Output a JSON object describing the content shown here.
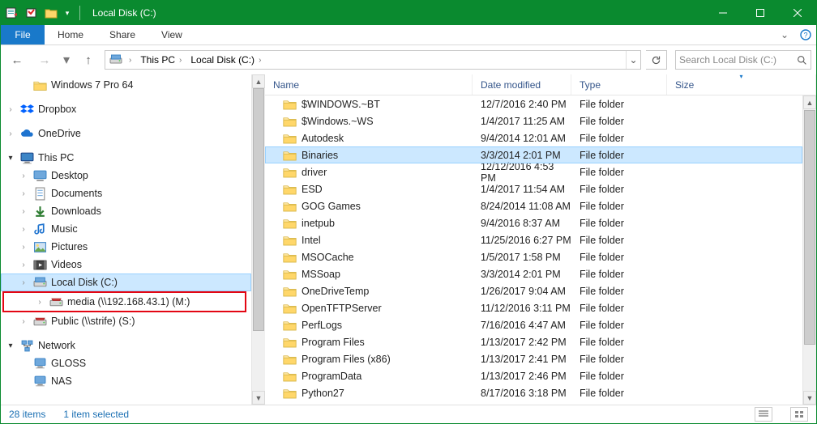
{
  "titlebar": {
    "title": "Local Disk (C:)"
  },
  "ribbon": {
    "file": "File",
    "home": "Home",
    "share": "Share",
    "view": "View"
  },
  "address": {
    "crumbs": [
      "This PC",
      "Local Disk (C:)",
      ""
    ],
    "search_placeholder": "Search Local Disk (C:)"
  },
  "tree": {
    "quick_access": "Windows 7 Pro 64",
    "dropbox": "Dropbox",
    "onedrive": "OneDrive",
    "this_pc": "This PC",
    "children": {
      "desktop": "Desktop",
      "documents": "Documents",
      "downloads": "Downloads",
      "music": "Music",
      "pictures": "Pictures",
      "videos": "Videos",
      "local_disk": "Local Disk (C:)",
      "media": "media (\\\\192.168.43.1) (M:)",
      "public": "Public (\\\\strife) (S:)"
    },
    "network": "Network",
    "net_children": {
      "gloss": "GLOSS",
      "nas": "NAS"
    }
  },
  "columns": {
    "name": "Name",
    "date": "Date modified",
    "type": "Type",
    "size": "Size"
  },
  "rows": [
    {
      "name": "$WINDOWS.~BT",
      "date": "12/7/2016 2:40 PM",
      "type": "File folder"
    },
    {
      "name": "$Windows.~WS",
      "date": "1/4/2017 11:25 AM",
      "type": "File folder"
    },
    {
      "name": "Autodesk",
      "date": "9/4/2014 12:01 AM",
      "type": "File folder"
    },
    {
      "name": "Binaries",
      "date": "3/3/2014 2:01 PM",
      "type": "File folder",
      "selected": true
    },
    {
      "name": "driver",
      "date": "12/12/2016 4:53 PM",
      "type": "File folder"
    },
    {
      "name": "ESD",
      "date": "1/4/2017 11:54 AM",
      "type": "File folder"
    },
    {
      "name": "GOG Games",
      "date": "8/24/2014 11:08 AM",
      "type": "File folder"
    },
    {
      "name": "inetpub",
      "date": "9/4/2016 8:37 AM",
      "type": "File folder"
    },
    {
      "name": "Intel",
      "date": "11/25/2016 6:27 PM",
      "type": "File folder"
    },
    {
      "name": "MSOCache",
      "date": "1/5/2017 1:58 PM",
      "type": "File folder"
    },
    {
      "name": "MSSoap",
      "date": "3/3/2014 2:01 PM",
      "type": "File folder"
    },
    {
      "name": "OneDriveTemp",
      "date": "1/26/2017 9:04 AM",
      "type": "File folder"
    },
    {
      "name": "OpenTFTPServer",
      "date": "11/12/2016 3:11 PM",
      "type": "File folder"
    },
    {
      "name": "PerfLogs",
      "date": "7/16/2016 4:47 AM",
      "type": "File folder"
    },
    {
      "name": "Program Files",
      "date": "1/13/2017 2:42 PM",
      "type": "File folder"
    },
    {
      "name": "Program Files (x86)",
      "date": "1/13/2017 2:41 PM",
      "type": "File folder"
    },
    {
      "name": "ProgramData",
      "date": "1/13/2017 2:46 PM",
      "type": "File folder"
    },
    {
      "name": "Python27",
      "date": "8/17/2016 3:18 PM",
      "type": "File folder"
    }
  ],
  "status": {
    "items": "28 items",
    "selected": "1 item selected"
  }
}
